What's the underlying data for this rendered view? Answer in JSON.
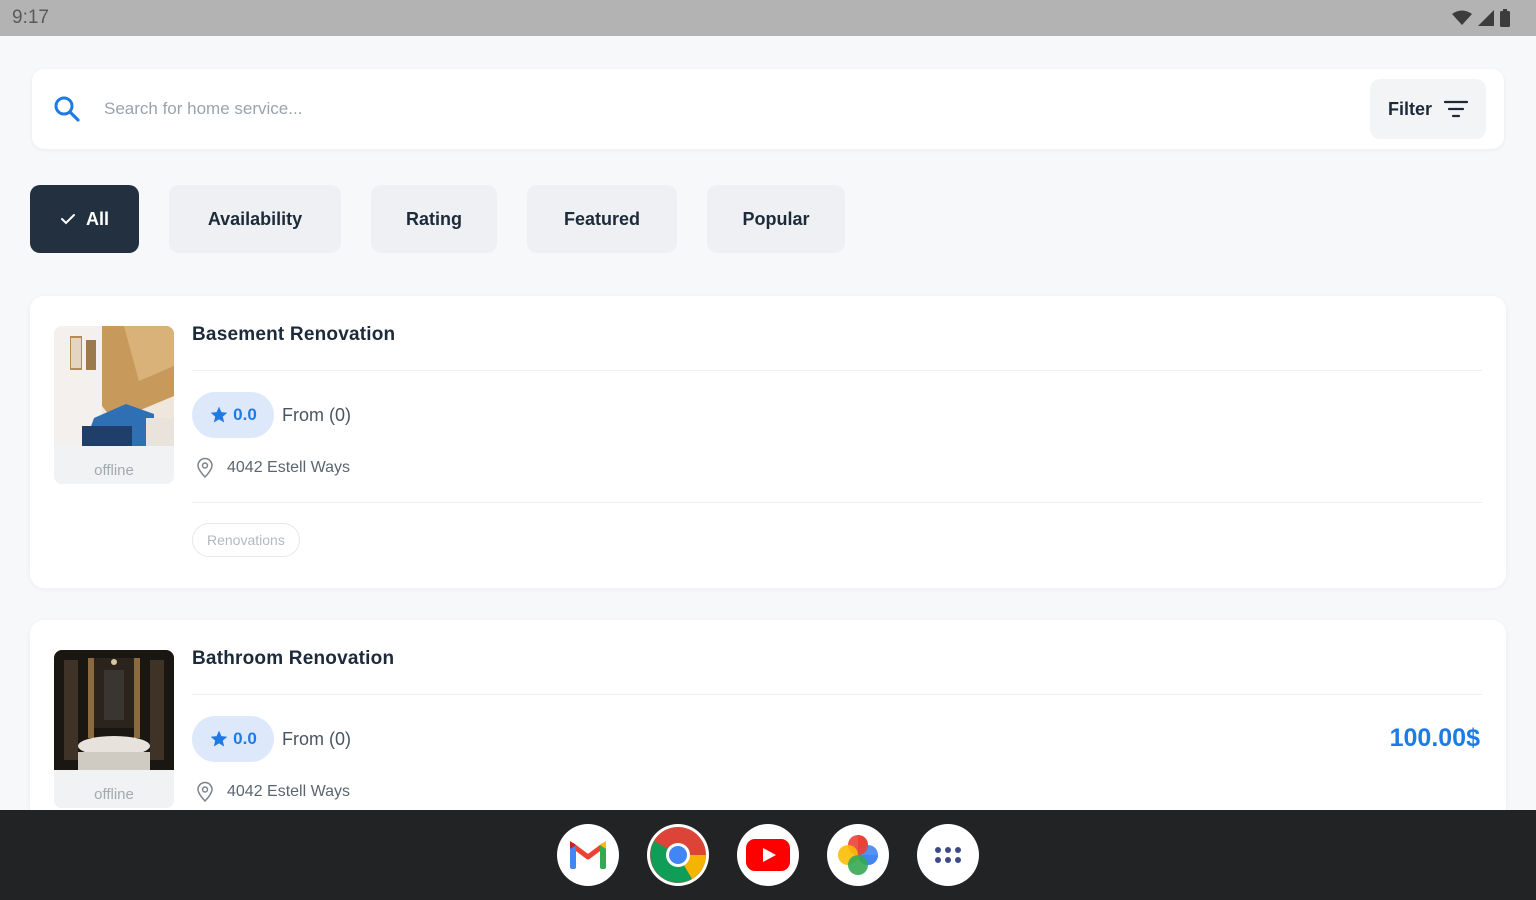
{
  "status_bar": {
    "time": "9:17"
  },
  "search": {
    "placeholder": "Search for home service...",
    "filter_label": "Filter"
  },
  "chips": [
    {
      "label": "All",
      "active": true
    },
    {
      "label": "Availability",
      "active": false
    },
    {
      "label": "Rating",
      "active": false
    },
    {
      "label": "Featured",
      "active": false
    },
    {
      "label": "Popular",
      "active": false
    }
  ],
  "services": [
    {
      "title": "Basement Renovation",
      "status": "offline",
      "rating": "0.0",
      "from": "From (0)",
      "location": "4042 Estell Ways",
      "tag": "Renovations",
      "price": ""
    },
    {
      "title": "Bathroom Renovation",
      "status": "offline",
      "rating": "0.0",
      "from": "From (0)",
      "location": "4042 Estell Ways",
      "price": "100.00$"
    }
  ],
  "dock": [
    "gmail-icon",
    "chrome-icon",
    "youtube-icon",
    "photos-icon",
    "app-drawer-icon"
  ],
  "colors": {
    "accent": "#1e7be6",
    "chip_active": "#23303f",
    "rating_bg": "#dde9fb"
  }
}
